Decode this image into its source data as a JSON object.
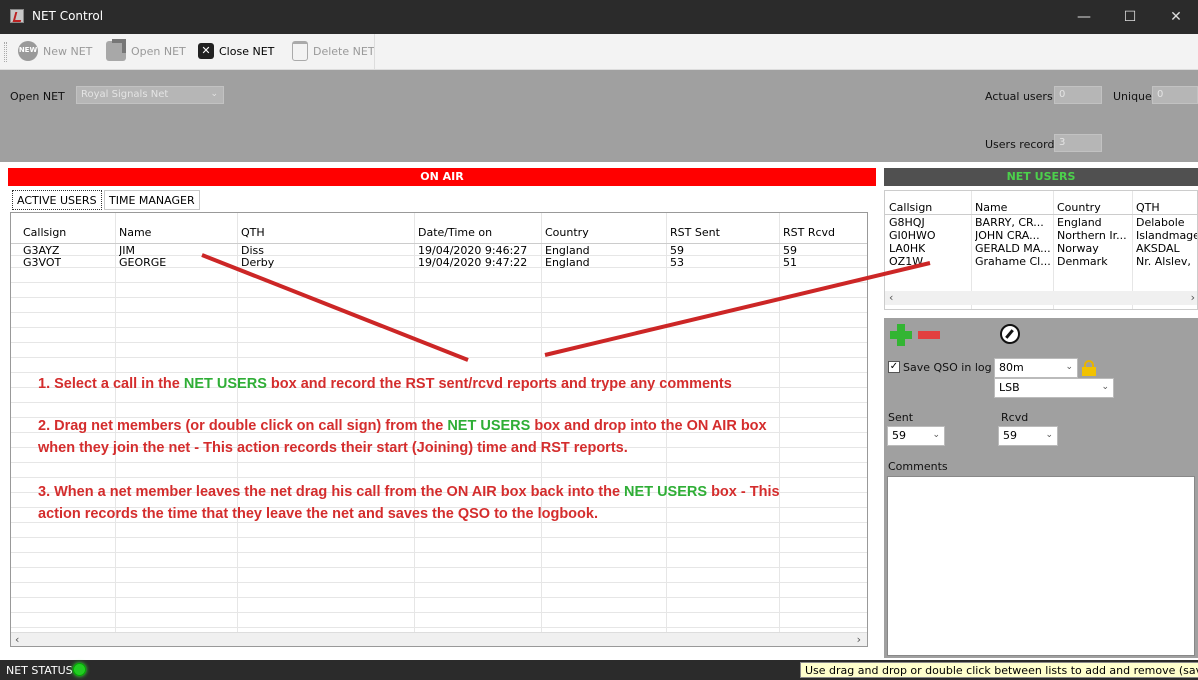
{
  "window": {
    "title": "NET Control",
    "minimize": "—",
    "maximize": "☐",
    "close": "✕"
  },
  "toolbar": {
    "new_net": "New NET",
    "new_badge": "NEW",
    "open_net": "Open NET",
    "close_net": "Close NET",
    "delete_net": "Delete NET"
  },
  "header": {
    "open_net_label": "Open NET",
    "open_net_value": "Royal Signals Net",
    "actual_users_label": "Actual users",
    "actual_users_value": "0",
    "unique_label": "Unique",
    "unique_value": "0",
    "users_record_label": "Users record",
    "users_record_value": "3"
  },
  "on_air": {
    "banner": "ON AIR",
    "tabs": [
      "ACTIVE USERS",
      "TIME MANAGER"
    ],
    "columns": [
      "Callsign",
      "Name",
      "QTH",
      "Date/Time on",
      "Country",
      "RST Sent",
      "RST Rcvd"
    ],
    "rows": [
      [
        "G3AYZ",
        "JIM",
        "Diss",
        "19/04/2020 9:46:27",
        "England",
        "59",
        "59"
      ],
      [
        "G3VOT",
        "GEORGE",
        "Derby",
        "19/04/2020 9:47:22",
        "England",
        "53",
        "51"
      ]
    ]
  },
  "net_users": {
    "banner": "NET USERS",
    "columns": [
      "Callsign",
      "Name",
      "Country",
      "QTH"
    ],
    "rows": [
      [
        "G8HQJ",
        "BARRY, CR...",
        "England",
        "Delabole"
      ],
      [
        "GI0HWO",
        "JOHN CRA...",
        "Northern Ir...",
        "Islandmage"
      ],
      [
        "LA0HK",
        "GERALD MA...",
        "Norway",
        "AKSDAL"
      ],
      [
        "OZ1W",
        "Grahame Cl...",
        "Denmark",
        "Nr. Alslev,"
      ]
    ]
  },
  "qso": {
    "save_label": "Save QSO in log",
    "band": "80m",
    "mode": "LSB",
    "sent_label": "Sent",
    "sent_value": "59",
    "rcvd_label": "Rcvd",
    "rcvd_value": "59",
    "comments_label": "Comments"
  },
  "instructions": {
    "step1_a": "1. Select a call in the ",
    "step1_b": "NET USERS",
    "step1_c": " box and record the RST sent/rcvd reports and trype any comments",
    "step2_a": "2. Drag net members (or double click on call sign) from the ",
    "step2_b": "NET USERS",
    "step2_c": " box and drop into the ON AIR box",
    "step2_line2": "when they join the net - This action records their start (Joining) time and RST reports.",
    "step3_a": "3. When a net member leaves the net drag his call from the ON AIR box back into the ",
    "step3_b": "NET USERS",
    "step3_c": " box - This",
    "step3_line2": "action records the time that they leave the net and saves the QSO to the logbook."
  },
  "status": {
    "label": "NET STATUS",
    "hint": "Use drag and drop or double click between lists to add and remove (save) QSO",
    "led_color": "#22cc22"
  }
}
